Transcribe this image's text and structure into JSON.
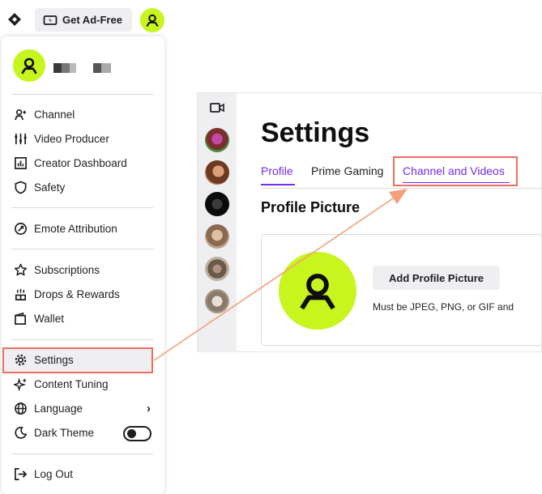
{
  "topbar": {
    "ad_free_label": "Get Ad-Free"
  },
  "menu": {
    "items": [
      {
        "label": "Channel",
        "icon": "channel-icon"
      },
      {
        "label": "Video Producer",
        "icon": "video-producer-icon"
      },
      {
        "label": "Creator Dashboard",
        "icon": "dashboard-icon"
      },
      {
        "label": "Safety",
        "icon": "shield-icon"
      },
      {
        "label": "Emote Attribution",
        "icon": "emote-icon"
      },
      {
        "label": "Subscriptions",
        "icon": "star-icon"
      },
      {
        "label": "Drops & Rewards",
        "icon": "gift-icon"
      },
      {
        "label": "Wallet",
        "icon": "wallet-icon"
      },
      {
        "label": "Settings",
        "icon": "gear-icon"
      },
      {
        "label": "Content Tuning",
        "icon": "sparkle-icon"
      },
      {
        "label": "Language",
        "icon": "globe-icon"
      },
      {
        "label": "Dark Theme",
        "icon": "moon-icon"
      },
      {
        "label": "Log Out",
        "icon": "logout-icon"
      }
    ],
    "dark_theme_on": false
  },
  "settings": {
    "title": "Settings",
    "tabs": [
      "Profile",
      "Prime Gaming",
      "Channel and Videos"
    ],
    "active_tab": "Profile",
    "section_title": "Profile Picture",
    "add_button": "Add Profile Picture",
    "hint": "Must be JPEG, PNG, or GIF and"
  },
  "colors": {
    "accent": "#772ce8",
    "avatar": "#c8f51e",
    "highlight": "#ee6f61"
  }
}
